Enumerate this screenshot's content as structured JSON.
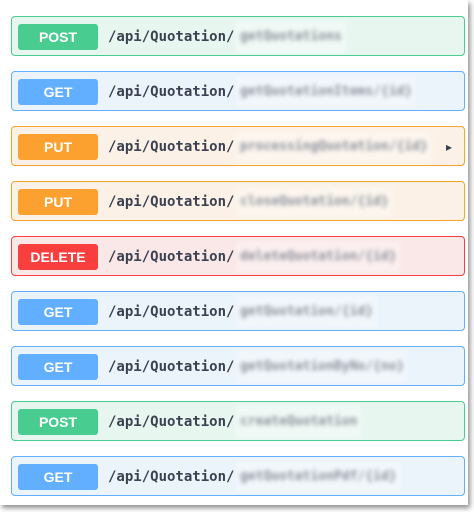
{
  "operations": [
    {
      "method": "POST",
      "path": "/api/Quotation/",
      "obscured": "getQuotations",
      "type": "post"
    },
    {
      "method": "GET",
      "path": "/api/Quotation/",
      "obscured": "getQuotationItems/{id}",
      "type": "get"
    },
    {
      "method": "PUT",
      "path": "/api/Quotation/",
      "obscured": "processingQuotation/{id}",
      "type": "put",
      "has_expand_arrow": true
    },
    {
      "method": "PUT",
      "path": "/api/Quotation/",
      "obscured": "closeQuotation/{id}",
      "type": "put"
    },
    {
      "method": "DELETE",
      "path": "/api/Quotation/",
      "obscured": "deleteQuotation/{id}",
      "type": "delete"
    },
    {
      "method": "GET",
      "path": "/api/Quotation/",
      "obscured": "getQuotation/{id}",
      "type": "get"
    },
    {
      "method": "GET",
      "path": "/api/Quotation/",
      "obscured": "getQuotationByNo/{no}",
      "type": "get"
    },
    {
      "method": "POST",
      "path": "/api/Quotation/",
      "obscured": "createQuotation",
      "type": "post"
    },
    {
      "method": "GET",
      "path": "/api/Quotation/",
      "obscured": "getQuotationPdf/{id}",
      "type": "get"
    }
  ],
  "colors": {
    "get": "#61affe",
    "post": "#49cc90",
    "put": "#fca130",
    "delete": "#f93e3e"
  },
  "icons": {
    "expand_arrow": "chevron-right-icon"
  }
}
